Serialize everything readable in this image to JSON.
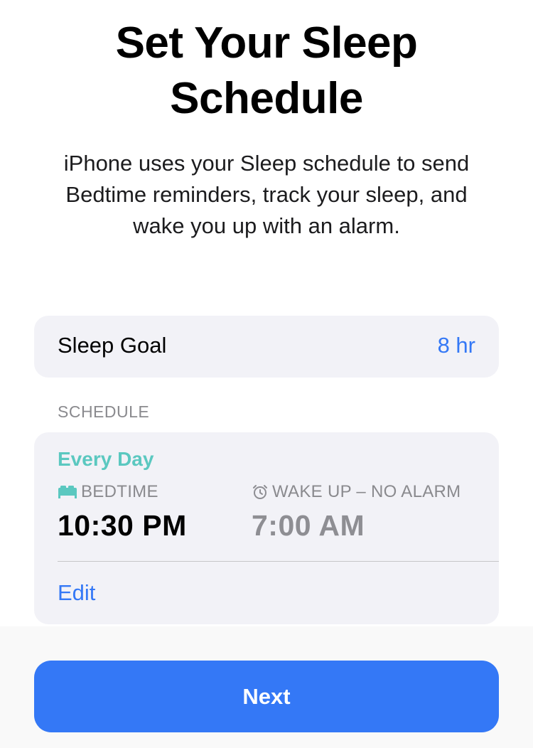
{
  "header": {
    "title_line1": "Set Your Sleep",
    "title_line2": "Schedule",
    "subtitle_line1": "iPhone uses your Sleep schedule to send",
    "subtitle_line2": "Bedtime reminders, track your sleep, and",
    "subtitle_line3": "wake you up with an alarm."
  },
  "sleep_goal": {
    "label": "Sleep Goal",
    "value": "8 hr"
  },
  "schedule": {
    "section_header": "SCHEDULE",
    "days": "Every Day",
    "bedtime_label": "BEDTIME",
    "bedtime_icon": "bed-icon",
    "bedtime_value": "10:30 PM",
    "wake_label": "WAKE UP – NO ALARM",
    "wake_icon": "alarm-clock-icon",
    "wake_value": "7:00 AM",
    "edit_label": "Edit"
  },
  "footer": {
    "next_label": "Next"
  },
  "colors": {
    "accent": "#3478f6",
    "teal": "#5bc8c0",
    "card": "#f2f2f7"
  }
}
